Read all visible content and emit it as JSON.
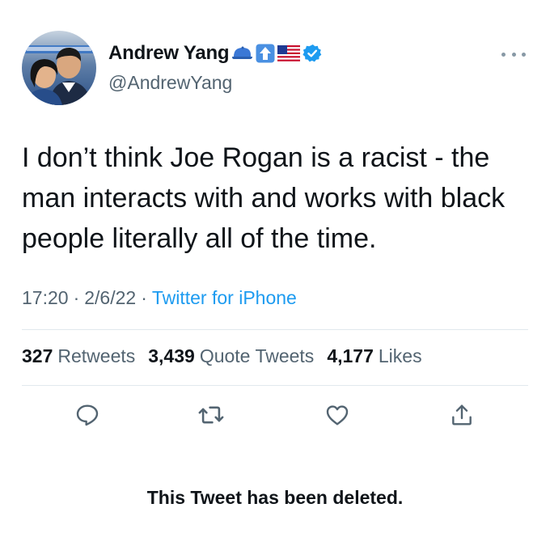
{
  "author": {
    "display_name": "Andrew Yang",
    "handle": "@AndrewYang",
    "badges": [
      "blue-cap-icon",
      "up-arrow-icon",
      "us-flag-icon",
      "verified-icon"
    ]
  },
  "tweet": {
    "text": "I don’t think Joe Rogan is a racist - the man interacts with and works with black people literally all of the time.",
    "time": "17:20",
    "date": "2/6/22",
    "separator": "·",
    "source": "Twitter for iPhone"
  },
  "stats": {
    "retweets_count": "327",
    "retweets_label": "Retweets",
    "quotes_count": "3,439",
    "quotes_label": "Quote Tweets",
    "likes_count": "4,177",
    "likes_label": "Likes"
  },
  "notice": "This Tweet has been deleted.",
  "colors": {
    "accent": "#1d9bf0",
    "icon_gray": "#536471",
    "divider": "#e1e8ed"
  }
}
